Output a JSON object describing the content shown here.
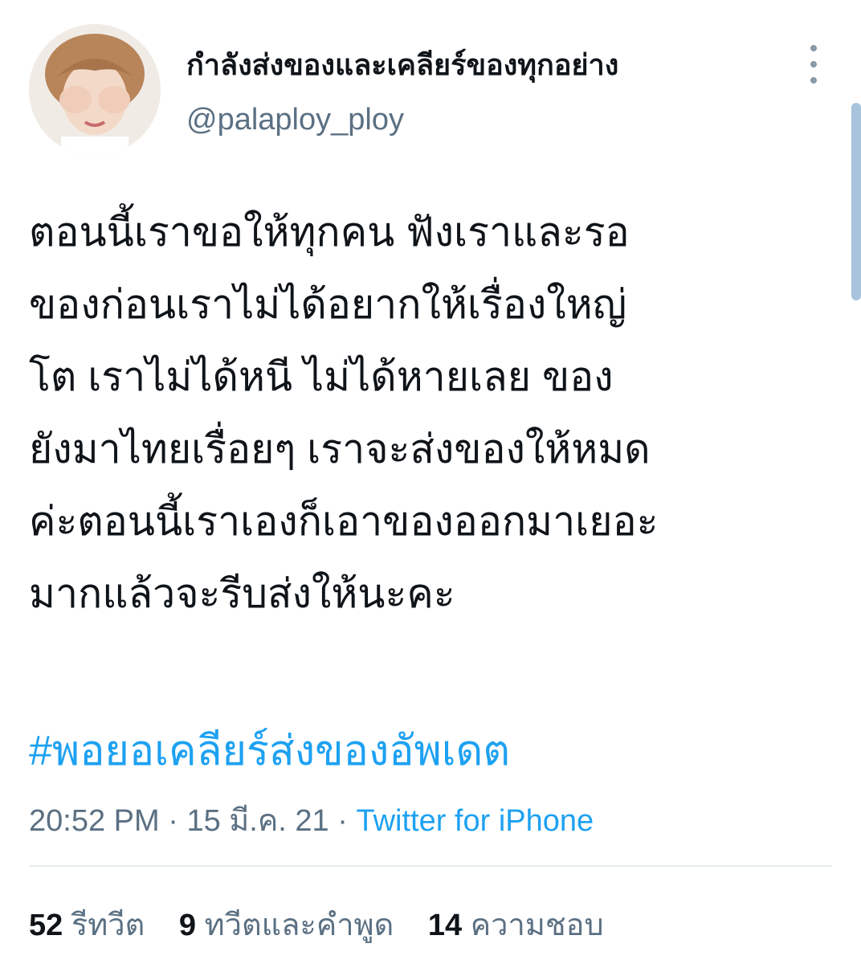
{
  "author": {
    "display_name": "กำลังส่งของและเคลียร์ของทุกอย่าง",
    "handle": "@palaploy_ploy"
  },
  "tweet": {
    "lines": [
      "ตอนนี้เราขอให้ทุกคน ฟังเราและรอ",
      "ของก่อนเราไม่ได้อยากให้เรื่องใหญ่",
      "โต เราไม่ได้หนี ไม่ได้หายเลย ของ",
      "ยังมาไทยเรื่อยๆ เราจะส่งของให้หมด",
      "ค่ะตอนนี้เราเองก็เอาของออกมาเยอะ",
      "มากแล้วจะรีบส่งให้นะคะ"
    ],
    "hashtag": "#พอยอเคลียร์ส่งของอัพเดต",
    "time": "20:52 PM",
    "date": "15 มี.ค. 21",
    "separator": "·",
    "source": "Twitter for iPhone"
  },
  "stats": {
    "retweets_count": "52",
    "retweets_label": "รีทวีต",
    "quotes_count": "9",
    "quotes_label": "ทวีตและคำพูด",
    "likes_count": "14",
    "likes_label": "ความชอบ"
  },
  "colors": {
    "link": "#1da1f2",
    "secondary_text": "#5b7083",
    "primary_text": "#0f1419"
  }
}
